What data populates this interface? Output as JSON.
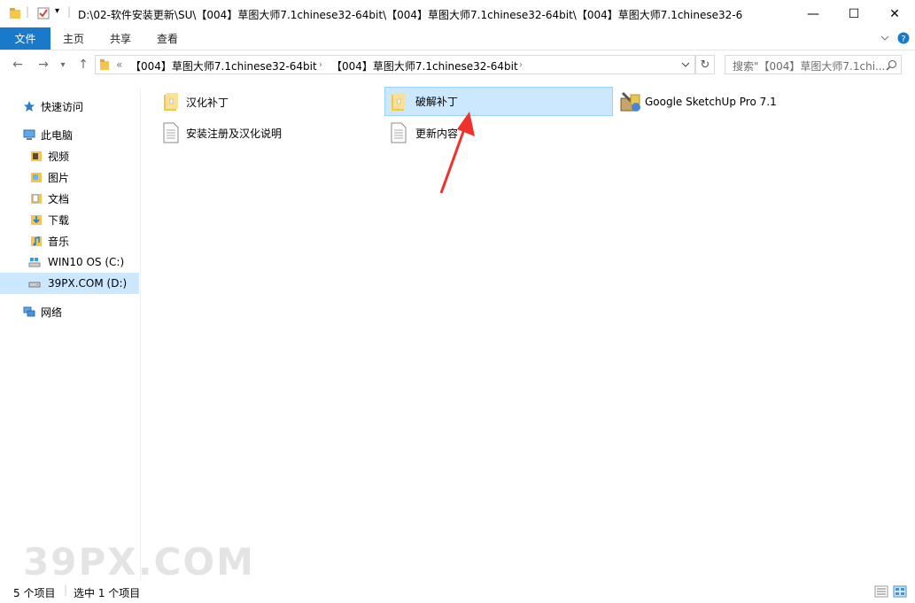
{
  "titlebar": {
    "path": "D:\\02-软件安装更新\\SU\\【004】草图大师7.1chinese32-64bit\\【004】草图大师7.1chinese32-64bit\\【004】草图大师7.1chinese32-6",
    "minimize": "—",
    "maximize": "☐",
    "close": "✕"
  },
  "ribbon": {
    "tabs": [
      "文件",
      "主页",
      "共享",
      "查看"
    ]
  },
  "address": {
    "overflow": "«",
    "crumbs": [
      "【004】草图大师7.1chinese32-64bit",
      "【004】草图大师7.1chinese32-64bit"
    ],
    "search_placeholder": "搜索\"【004】草图大师7.1chi..."
  },
  "nav": {
    "quick_access": "快速访问",
    "this_pc": "此电脑",
    "items": [
      "视频",
      "图片",
      "文档",
      "下载",
      "音乐"
    ],
    "drive_c": "WIN10 OS (C:)",
    "drive_d": "39PX.COM (D:)",
    "network": "网络"
  },
  "files": [
    {
      "name": "汉化补丁",
      "kind": "folder"
    },
    {
      "name": "破解补丁",
      "kind": "folder",
      "selected": true
    },
    {
      "name": "Google SketchUp Pro 7.1",
      "kind": "app"
    },
    {
      "name": "安装注册及汉化说明",
      "kind": "doc"
    },
    {
      "name": "更新内容",
      "kind": "doc"
    }
  ],
  "status": {
    "count": "5 个项目",
    "selected": "选中 1 个项目"
  },
  "watermark": "39PX.COM",
  "colors": {
    "accent": "#1979ca",
    "selection": "#cce8ff",
    "arrow": "#f0322d"
  }
}
